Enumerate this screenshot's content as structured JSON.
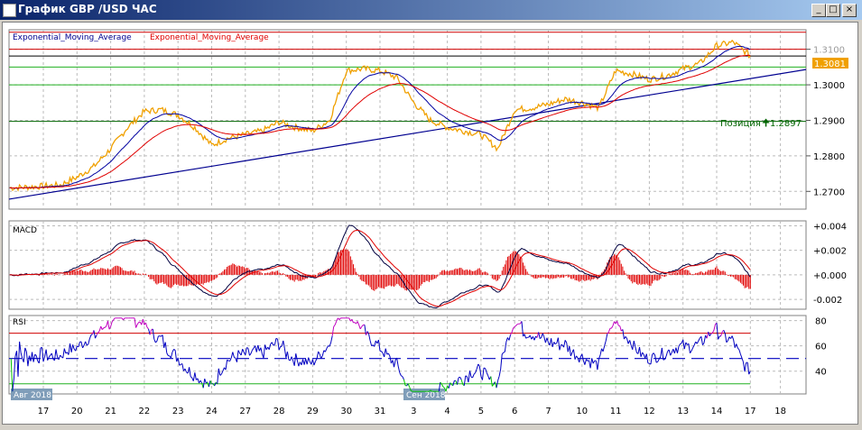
{
  "window": {
    "title": "График GBP /USD  ЧАС",
    "min_label": "_",
    "max_label": "□",
    "close_label": "×"
  },
  "legend": {
    "ema1": "Exponential_Moving_Average",
    "ema2": "Exponential_Moving_Average"
  },
  "colors": {
    "price": "#f0a000",
    "ema_fast": "#0000a0",
    "ema_slow": "#e00000",
    "trend": "#000090",
    "resistance": "#d00000",
    "support": "#20b020",
    "position": "#006400",
    "macd": "#000040",
    "signal": "#e00000",
    "hist": "#e00000",
    "rsi": "#0000c0",
    "rsi_over": "#c000c0",
    "rsi_under": "#00c000"
  },
  "chart_data": [
    {
      "type": "line",
      "title": "",
      "ylim": [
        1.265,
        1.3155
      ],
      "yticks": [
        "1.3100",
        "1.3000",
        "1.2900",
        "1.2800",
        "1.2700"
      ],
      "current_price": "1.3081",
      "position": {
        "label": "Позиция",
        "price": "1.2897"
      },
      "hlines": [
        {
          "value": 1.3148,
          "color": "resistance"
        },
        {
          "value": 1.31,
          "color": "resistance"
        },
        {
          "value": 1.3081,
          "color": "black"
        },
        {
          "value": 1.305,
          "color": "support"
        },
        {
          "value": 1.3,
          "color": "support"
        },
        {
          "value": 1.2897,
          "color": "position"
        }
      ],
      "trendline": {
        "from": 1.2678,
        "to": 1.3043
      },
      "xticks": [
        "17",
        "20",
        "21",
        "22",
        "23",
        "24",
        "27",
        "28",
        "29",
        "30",
        "31",
        "3",
        "4",
        "5",
        "6",
        "7",
        "10",
        "11",
        "12",
        "13",
        "14",
        "17",
        "18"
      ],
      "month_labels": [
        {
          "at": "17",
          "text": "Авг 2018"
        },
        {
          "at": "3",
          "text": "Сен 2018"
        }
      ],
      "price_half_day": [
        1.271,
        1.2712,
        1.2715,
        1.2718,
        1.274,
        1.277,
        1.282,
        1.288,
        1.2925,
        1.293,
        1.2915,
        1.288,
        1.283,
        1.285,
        1.286,
        1.287,
        1.2895,
        1.288,
        1.287,
        1.29,
        1.304,
        1.3045,
        1.304,
        1.302,
        1.295,
        1.29,
        1.288,
        1.287,
        1.286,
        1.282,
        1.293,
        1.2935,
        1.2945,
        1.296,
        1.295,
        1.2935,
        1.304,
        1.303,
        1.3015,
        1.3025,
        1.3045,
        1.306,
        1.311,
        1.312,
        1.3081
      ]
    },
    {
      "type": "line",
      "title": "MACD",
      "ylim": [
        -0.0028,
        0.0044
      ],
      "yticks": [
        "+0.004",
        "+0.002",
        "+0.000",
        "-0.002"
      ]
    },
    {
      "type": "line",
      "title": "RSI",
      "ylim": [
        22,
        84
      ],
      "yticks": [
        "80",
        "60",
        "40"
      ],
      "levels": [
        70,
        50,
        30
      ]
    }
  ]
}
